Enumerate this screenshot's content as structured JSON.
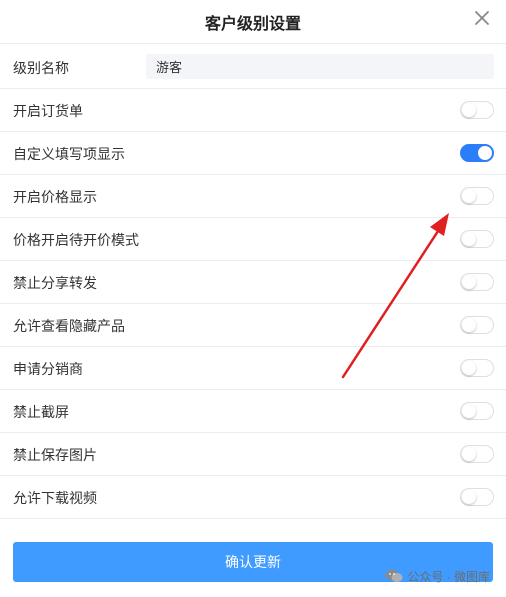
{
  "dialog": {
    "title": "客户级别设置",
    "close_icon": "close-icon"
  },
  "level_name": {
    "label": "级别名称",
    "value": "游客"
  },
  "settings": [
    {
      "label": "开启订货单",
      "enabled": false
    },
    {
      "label": "自定义填写项显示",
      "enabled": true
    },
    {
      "label": "开启价格显示",
      "enabled": false
    },
    {
      "label": "价格开启待开价模式",
      "enabled": false
    },
    {
      "label": "禁止分享转发",
      "enabled": false
    },
    {
      "label": "允许查看隐藏产品",
      "enabled": false
    },
    {
      "label": "申请分销商",
      "enabled": false
    },
    {
      "label": "禁止截屏",
      "enabled": false
    },
    {
      "label": "禁止保存图片",
      "enabled": false
    },
    {
      "label": "允许下载视频",
      "enabled": false
    }
  ],
  "confirm_button": "确认更新",
  "watermark": {
    "text": "公众号 · 微图库",
    "icon": "wechat-icon"
  },
  "colors": {
    "switch_on": "#2c7ef8",
    "button": "#3f9bff",
    "arrow": "#e02020"
  }
}
